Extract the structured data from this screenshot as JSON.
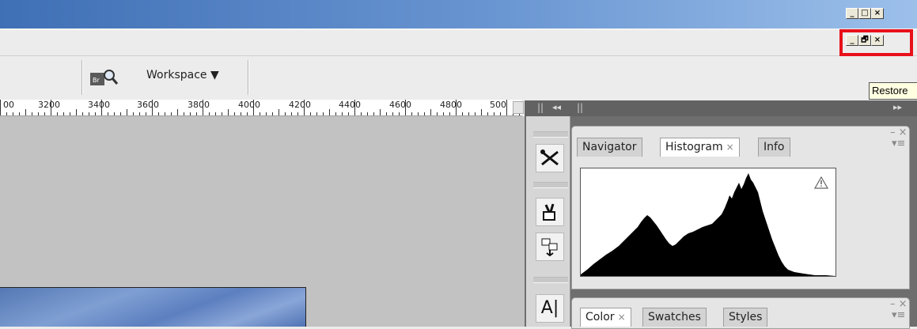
{
  "window": {
    "title_controls": [
      "_",
      "□",
      "×"
    ],
    "doc_controls": [
      "_",
      "🗗",
      "×"
    ]
  },
  "tooltip": {
    "text": "Restore"
  },
  "options_bar": {
    "bridge_icon": "bridge-icon",
    "workspace_label": "Workspace ▼"
  },
  "ruler": {
    "labels": [
      "00",
      "3200",
      "3400",
      "3600",
      "3800",
      "4000",
      "4200",
      "4400",
      "4600",
      "4800",
      "500"
    ]
  },
  "dock": {
    "header_left": "◂◂",
    "header_right": "▸▸",
    "tools": [
      "tools-icon",
      "brush-icon",
      "layer-comps-icon",
      "type-icon"
    ]
  },
  "panel_histogram": {
    "tabs": [
      {
        "label": "Navigator",
        "active": false,
        "closable": false
      },
      {
        "label": "Histogram",
        "active": true,
        "closable": true
      },
      {
        "label": "Info",
        "active": false,
        "closable": false
      }
    ],
    "warning_icon": "warning-icon",
    "menu_icon": "panel-menu-icon"
  },
  "panel_color": {
    "tabs": [
      {
        "label": "Color",
        "active": true,
        "closable": true
      },
      {
        "label": "Swatches",
        "active": false,
        "closable": false
      },
      {
        "label": "Styles",
        "active": false,
        "closable": false
      }
    ]
  },
  "colors": {
    "highlight": "#e8101a",
    "titlebar_start": "#3f6fb5",
    "titlebar_end": "#9cc0ea"
  }
}
